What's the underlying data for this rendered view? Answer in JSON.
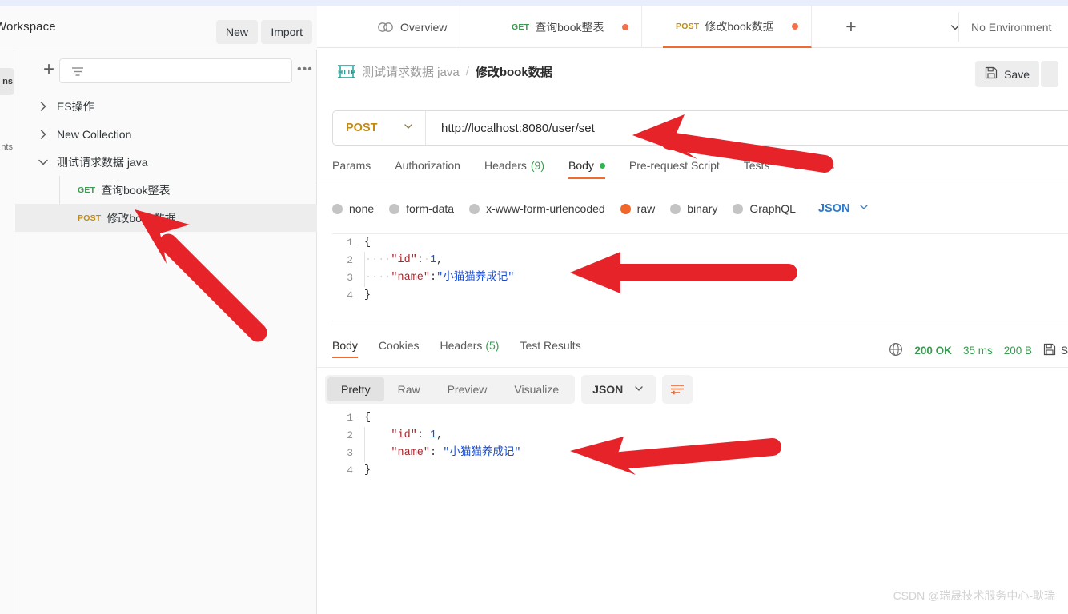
{
  "workspace": {
    "title": "Workspace",
    "new_label": "New",
    "import_label": "Import"
  },
  "rail": {
    "items": [
      {
        "label": "ns",
        "name": "collections"
      },
      {
        "label": "nts",
        "name": "environments"
      }
    ]
  },
  "sidebar": {
    "filter_placeholder": "",
    "plus_label": "+",
    "more_label": "•••",
    "tree": [
      {
        "label": "ES操作",
        "expanded": false,
        "type": "collection"
      },
      {
        "label": "New Collection",
        "expanded": false,
        "type": "collection"
      },
      {
        "label": "测试请求数据 java",
        "expanded": true,
        "type": "collection"
      }
    ],
    "requests": [
      {
        "verb": "GET",
        "label": "查询book整表",
        "selected": false
      },
      {
        "verb": "POST",
        "label": "修改book数据",
        "selected": true
      }
    ]
  },
  "tabs": {
    "overview_label": "Overview",
    "items": [
      {
        "verb": "GET",
        "label": "查询book整表",
        "active": false,
        "dirty": true
      },
      {
        "verb": "POST",
        "label": "修改book数据",
        "active": true,
        "dirty": true
      }
    ],
    "add_label": "+",
    "environment_label": "No Environment"
  },
  "breadcrumb": {
    "protocol": "HTTP",
    "parent": "测试请求数据 java",
    "separator": "/",
    "current": "修改book数据",
    "save_label": "Save"
  },
  "request": {
    "method": "POST",
    "url": "http://localhost:8080/user/set",
    "tabs": [
      {
        "label": "Params",
        "active": false
      },
      {
        "label": "Authorization",
        "active": false
      },
      {
        "label": "Headers",
        "count": "(9)",
        "active": false
      },
      {
        "label": "Body",
        "active": true,
        "dot": true
      },
      {
        "label": "Pre-request Script",
        "active": false
      },
      {
        "label": "Tests",
        "active": false
      },
      {
        "label": "Settings",
        "active": false
      }
    ],
    "body_types": [
      {
        "label": "none",
        "selected": false
      },
      {
        "label": "form-data",
        "selected": false
      },
      {
        "label": "x-www-form-urlencoded",
        "selected": false
      },
      {
        "label": "raw",
        "selected": true
      },
      {
        "label": "binary",
        "selected": false
      },
      {
        "label": "GraphQL",
        "selected": false
      }
    ],
    "format_label": "JSON",
    "body_lines": [
      {
        "n": "1",
        "open": "{"
      },
      {
        "n": "2",
        "dots": "····",
        "key": "\"id\"",
        "colon": ":",
        "dot2": "·",
        "num": "1",
        "comma": ","
      },
      {
        "n": "3",
        "dots": "····",
        "key": "\"name\"",
        "colon": ":",
        "str": "\"小猫猫养成记\""
      },
      {
        "n": "4",
        "close": "}"
      }
    ]
  },
  "response": {
    "tabs": [
      {
        "label": "Body",
        "active": true
      },
      {
        "label": "Cookies",
        "active": false
      },
      {
        "label": "Headers",
        "count": "(5)",
        "active": false
      },
      {
        "label": "Test Results",
        "active": false
      }
    ],
    "status": "200 OK",
    "time": "35 ms",
    "size": "200 B",
    "save_response_label": "S",
    "format_buttons": [
      {
        "label": "Pretty",
        "active": true
      },
      {
        "label": "Raw",
        "active": false
      },
      {
        "label": "Preview",
        "active": false
      },
      {
        "label": "Visualize",
        "active": false
      }
    ],
    "format_label": "JSON",
    "body_lines": [
      {
        "n": "1",
        "open": "{"
      },
      {
        "n": "2",
        "indent": "    ",
        "key": "\"id\"",
        "colon": ": ",
        "num": "1",
        "comma": ","
      },
      {
        "n": "3",
        "indent": "    ",
        "key": "\"name\"",
        "colon": ": ",
        "str": "\"小猫猫养成记\""
      },
      {
        "n": "4",
        "close": "}"
      }
    ]
  },
  "annotations": {
    "arrow_color": "#E7232A",
    "count": 4
  },
  "watermark": {
    "text": "CSDN @瑞晟技术服务中心-耿瑞"
  }
}
